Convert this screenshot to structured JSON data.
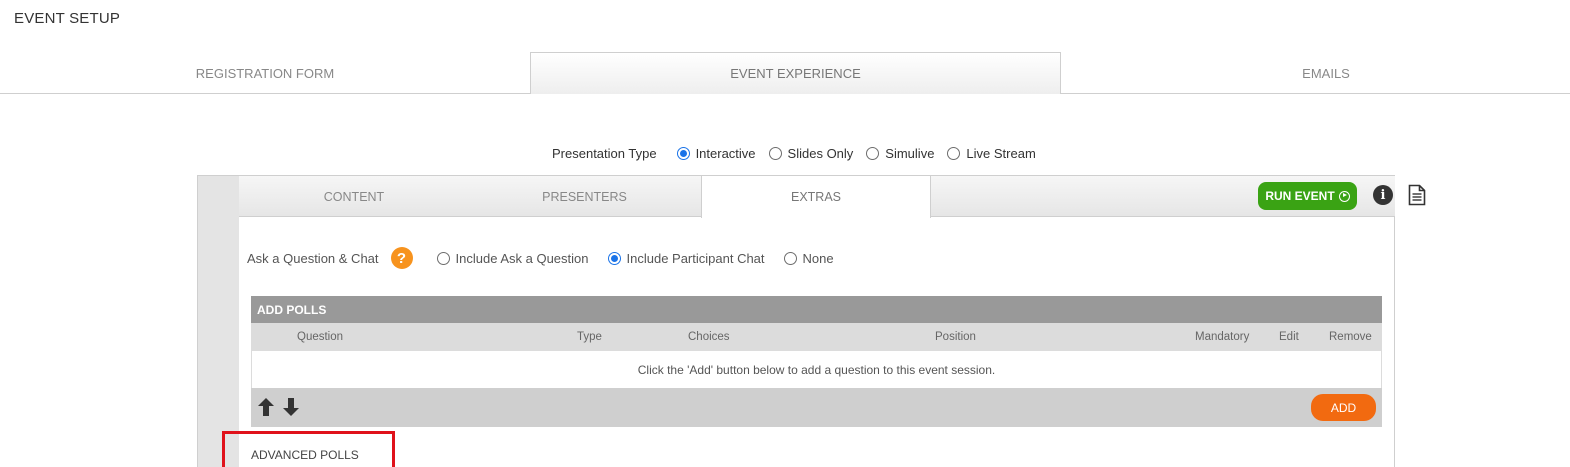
{
  "page": {
    "title": "EVENT SETUP"
  },
  "main_tabs": [
    {
      "label": "REGISTRATION FORM"
    },
    {
      "label": "EVENT EXPERIENCE"
    },
    {
      "label": "EMAILS"
    }
  ],
  "presentation": {
    "label": "Presentation Type",
    "options": [
      {
        "label": "Interactive",
        "selected": true
      },
      {
        "label": "Slides Only",
        "selected": false
      },
      {
        "label": "Simulive",
        "selected": false
      },
      {
        "label": "Live Stream",
        "selected": false
      }
    ]
  },
  "sub_tabs": [
    {
      "label": "CONTENT"
    },
    {
      "label": "PRESENTERS"
    },
    {
      "label": "EXTRAS"
    }
  ],
  "toolbar": {
    "run_event": "RUN EVENT",
    "info_glyph": "i"
  },
  "ask": {
    "label": "Ask a Question & Chat",
    "help_glyph": "?",
    "options": [
      {
        "label": "Include Ask a Question",
        "selected": false
      },
      {
        "label": "Include Participant Chat",
        "selected": true
      },
      {
        "label": "None",
        "selected": false
      }
    ]
  },
  "polls": {
    "header": "ADD POLLS",
    "columns": [
      "Question",
      "Type",
      "Choices",
      "Position",
      "Mandatory",
      "Edit",
      "Remove"
    ],
    "empty_message": "Click the 'Add' button below to add a question to this event session.",
    "add_label": "ADD"
  },
  "advanced_polls": {
    "label": "ADVANCED POLLS"
  },
  "colors": {
    "run_green": "#3aa314",
    "add_orange": "#f26a10",
    "help_orange": "#f7931e",
    "highlight_red": "#e0121b",
    "radio_blue": "#1a73e8"
  }
}
